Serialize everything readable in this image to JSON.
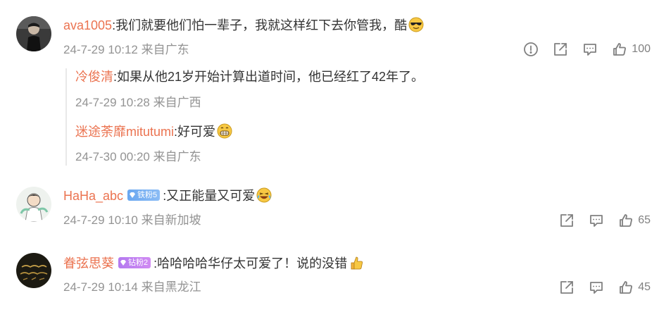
{
  "comments": [
    {
      "user": "ava1005",
      "separator": ":",
      "text": "我们就要他们怕一辈子，我就这样红下去你管我，酷",
      "emoji": "sunglasses-emoji",
      "time": "24-7-29 10:12",
      "location": "来自广东",
      "likes": "100",
      "has_report": true,
      "replies": [
        {
          "user": "冷俊清",
          "separator": ":",
          "text": "如果从他21岁开始计算出道时间，他已经红了42年了。",
          "time": "24-7-29 10:28",
          "location": "来自广西"
        },
        {
          "user": "迷途荼靡mitutumi",
          "separator": ":",
          "text": "好可爱",
          "emoji": "grin-emoji",
          "time": "24-7-30 00:20",
          "location": "来自广东"
        }
      ]
    },
    {
      "user": "HaHa_abc",
      "badge": "铁粉5",
      "separator": ":",
      "text": "又正能量又可爱",
      "emoji": "laugh-tears-emoji",
      "time": "24-7-29 10:10",
      "location": "来自新加坡",
      "likes": "65"
    },
    {
      "user": "眷弦思葵",
      "badge": "钻粉2",
      "separator": ":",
      "text": "哈哈哈哈华仔太可爱了！说的没错",
      "emoji": "thumbs-up-emoji",
      "time": "24-7-29 10:14",
      "location": "来自黑龙江",
      "likes": "45"
    }
  ],
  "colors": {
    "username": "#eb7350",
    "meta": "#939393",
    "icon": "#808080"
  }
}
